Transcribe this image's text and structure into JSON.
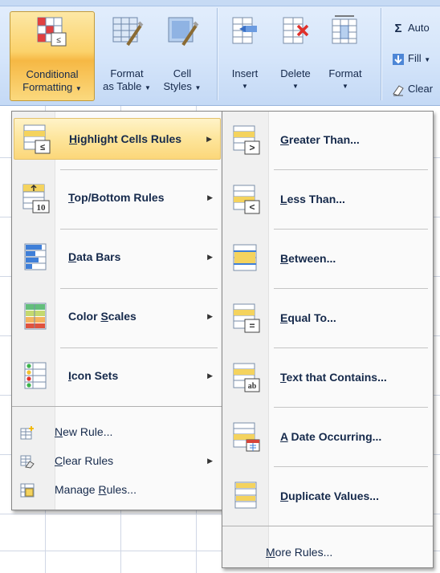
{
  "ribbon": {
    "buttons": [
      {
        "line1": "Conditional",
        "line2": "Formatting",
        "icon": "conditional-formatting-icon"
      },
      {
        "line1": "Format",
        "line2": "as Table",
        "icon": "format-as-table-icon"
      },
      {
        "line1": "Cell",
        "line2": "Styles",
        "icon": "cell-styles-icon"
      },
      {
        "line1": "Insert",
        "line2": "",
        "icon": "insert-cells-icon"
      },
      {
        "line1": "Delete",
        "line2": "",
        "icon": "delete-cells-icon"
      },
      {
        "line1": "Format",
        "line2": "",
        "icon": "format-cells-icon"
      }
    ],
    "editing": [
      {
        "label": "Auto",
        "icon": "sigma-icon"
      },
      {
        "label": "Fill",
        "icon": "fill-down-icon"
      },
      {
        "label": "Clear",
        "icon": "eraser-icon"
      }
    ]
  },
  "cf_menu": {
    "items": [
      {
        "pre": "",
        "key": "H",
        "post": "ighlight Cells Rules",
        "icon": "highlight-cells-rules-icon",
        "submenu": true
      },
      {
        "pre": "",
        "key": "T",
        "post": "op/Bottom Rules",
        "icon": "top-bottom-rules-icon",
        "submenu": true
      },
      {
        "pre": "",
        "key": "D",
        "post": "ata Bars",
        "icon": "data-bars-icon",
        "submenu": true
      },
      {
        "pre": "Color ",
        "key": "S",
        "post": "cales",
        "icon": "color-scales-icon",
        "submenu": true
      },
      {
        "pre": "",
        "key": "I",
        "post": "con Sets",
        "icon": "icon-sets-icon",
        "submenu": true
      }
    ],
    "small_items": [
      {
        "pre": "",
        "key": "N",
        "post": "ew Rule...",
        "icon": "new-rule-icon",
        "submenu": false
      },
      {
        "pre": "",
        "key": "C",
        "post": "lear Rules",
        "icon": "clear-rules-icon",
        "submenu": true
      },
      {
        "pre": "Manage ",
        "key": "R",
        "post": "ules...",
        "icon": "manage-rules-icon",
        "submenu": false
      }
    ]
  },
  "hcr_menu": {
    "items": [
      {
        "pre": "",
        "key": "G",
        "post": "reater Than...",
        "icon": "greater-than-icon"
      },
      {
        "pre": "",
        "key": "L",
        "post": "ess Than...",
        "icon": "less-than-icon"
      },
      {
        "pre": "",
        "key": "B",
        "post": "etween...",
        "icon": "between-icon"
      },
      {
        "pre": "",
        "key": "E",
        "post": "qual To...",
        "icon": "equal-to-icon"
      },
      {
        "pre": "",
        "key": "T",
        "post": "ext that Contains...",
        "icon": "text-contains-icon"
      },
      {
        "pre": "",
        "key": "A",
        "post": " Date Occurring...",
        "icon": "date-occurring-icon"
      },
      {
        "pre": "",
        "key": "D",
        "post": "uplicate Values...",
        "icon": "duplicate-values-icon"
      }
    ],
    "more": {
      "pre": "",
      "key": "M",
      "post": "ore Rules..."
    }
  },
  "colors": {
    "highlight": "#fcd77a",
    "ribbon": "#d5e5fa",
    "accent": "#15294b"
  }
}
